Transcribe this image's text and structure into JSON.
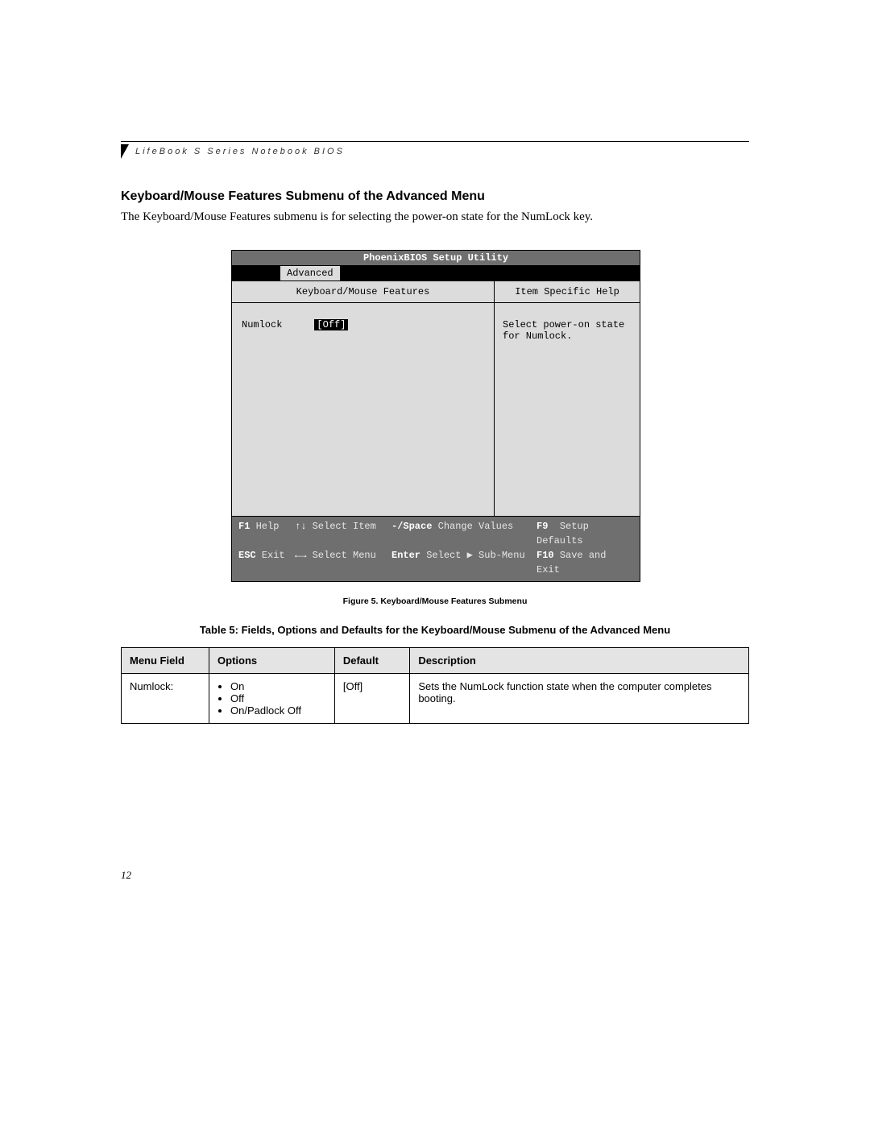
{
  "header": {
    "running_head": "LifeBook S Series Notebook BIOS"
  },
  "section": {
    "title": "Keyboard/Mouse Features Submenu of the Advanced Menu",
    "intro": "The Keyboard/Mouse Features submenu is for selecting the power-on state for the NumLock key."
  },
  "bios": {
    "title": "PhoenixBIOS Setup Utility",
    "active_tab": "Advanced",
    "left_heading": "Keyboard/Mouse Features",
    "right_heading": "Item Specific Help",
    "field_label": "Numlock",
    "field_value": "[Off]",
    "help_text": "Select power-on state for Numlock.",
    "footer": {
      "r1": {
        "k1": "F1",
        "t1": "Help",
        "a2": "↑↓",
        "t2": "Select Item",
        "k3": "-/Space",
        "t3": "Change Values",
        "k4": "F9",
        "t4": "Setup Defaults"
      },
      "r2": {
        "k1": "ESC",
        "t1": "Exit",
        "a2": "←→",
        "t2": "Select Menu",
        "k3": "Enter",
        "t3": "Select ▶ Sub-Menu",
        "k4": "F10",
        "t4": "Save and Exit"
      }
    }
  },
  "figure_caption": "Figure 5.  Keyboard/Mouse Features Submenu",
  "table_caption": "Table 5: Fields, Options and Defaults for the Keyboard/Mouse Submenu of the Advanced Menu",
  "table": {
    "headers": {
      "c1": "Menu Field",
      "c2": "Options",
      "c3": "Default",
      "c4": "Description"
    },
    "rows": [
      {
        "field": "Numlock:",
        "options": [
          "On",
          "Off",
          "On/Padlock Off"
        ],
        "default": "[Off]",
        "description": "Sets the NumLock function state when the computer completes booting."
      }
    ]
  },
  "page_number": "12"
}
